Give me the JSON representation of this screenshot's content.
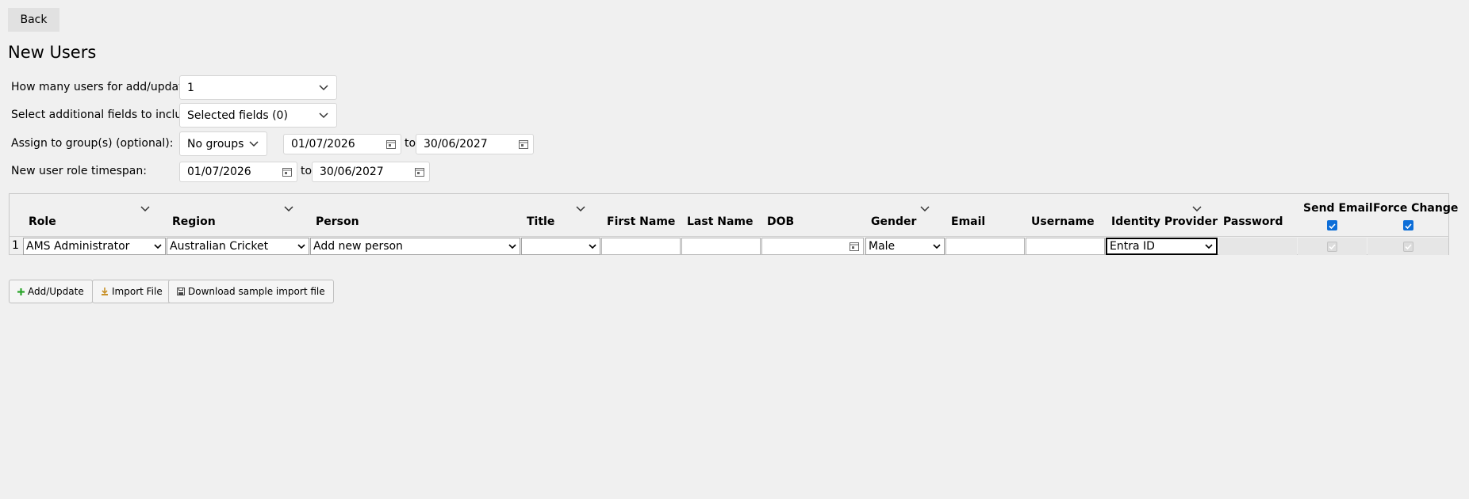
{
  "back_label": "Back",
  "page_title": "New Users",
  "form": {
    "count_label": "How many users for add/update?",
    "count_value": "1",
    "fields_label": "Select additional fields to include:",
    "fields_value": "Selected fields (0)",
    "groups_label": "Assign to group(s) (optional):",
    "groups_value": "No groups",
    "group_from": "01/07/2026",
    "group_to": "30/06/2027",
    "timespan_label": "New user role timespan:",
    "timespan_from": "01/07/2026",
    "timespan_to": "30/06/2027",
    "to_word": "to"
  },
  "grid": {
    "headers": {
      "role": "Role",
      "region": "Region",
      "person": "Person",
      "title": "Title",
      "first_name": "First Name",
      "last_name": "Last Name",
      "dob": "DOB",
      "gender": "Gender",
      "email": "Email",
      "username": "Username",
      "identity_provider": "Identity Provider",
      "password": "Password",
      "send_email": "Send Email",
      "force_change": "Force Change"
    },
    "row": {
      "number": "1",
      "role": "AMS Administrator",
      "region": "Australian Cricket",
      "person": "Add new person",
      "title": "",
      "gender": "Male",
      "identity_provider": "Entra ID"
    },
    "header_send_email_checked": true,
    "header_force_change_checked": true,
    "row_send_email_checked": true,
    "row_force_change_checked": true
  },
  "actions": {
    "add_update": "Add/Update",
    "import_file": "Import File",
    "download_sample": "Download sample import file"
  },
  "colors": {
    "background": "#f0f0f0",
    "accent_checkbox": "#0d6ed8",
    "add_icon": "#2aa52a"
  }
}
